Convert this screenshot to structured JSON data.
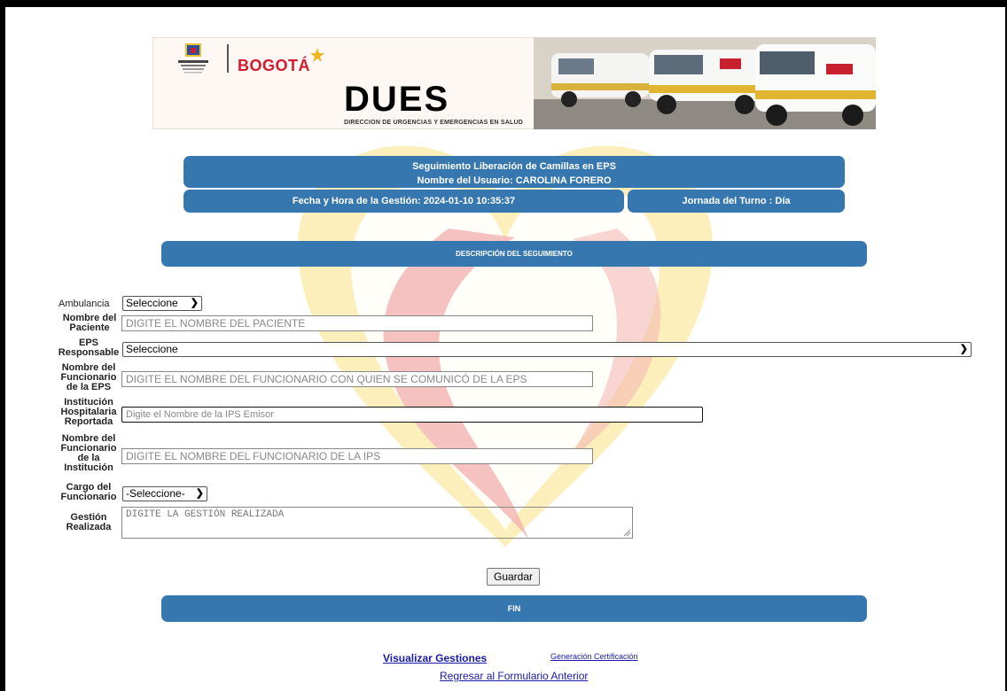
{
  "banner": {
    "brand": "BOGOTÁ",
    "title": "DUES",
    "subtitle": "DIRECCION DE URGENCIAS Y EMERGENCIAS EN SALUD"
  },
  "header": {
    "form_title": "Seguimiento Liberación de Camillas en EPS",
    "user_label": "Nombre del Usuario: CAROLINA FORERO",
    "datetime_label": "Fecha y Hora de la Gestión: 2024-01-10 10:35:37",
    "shift_label": "Jornada del Turno : Día"
  },
  "section_title": "DESCRIPCIÓN DEL SEGUIMIENTO",
  "form": {
    "ambulancia": {
      "label": "Ambulancia",
      "value": "Seleccione"
    },
    "paciente": {
      "label": [
        "Nombre del",
        "Paciente"
      ],
      "placeholder": "DIGITE EL NOMBRE DEL PACIENTE"
    },
    "eps": {
      "label": [
        "EPS",
        "Responsable"
      ],
      "value": "Seleccione"
    },
    "funcionario_eps": {
      "label": [
        "Nombre del",
        "Funcionario",
        "de la EPS"
      ],
      "placeholder": "DIGITE EL NOMBRE DEL FUNCIONARIO CON QUIEN SE COMUNICÓ DE LA EPS"
    },
    "institucion": {
      "label": [
        "Institución",
        "Hospitalaria",
        "Reportada"
      ],
      "placeholder": "Digite el Nombre de la IPS Emisor"
    },
    "funcionario_ips": {
      "label": [
        "Nombre del",
        "Funcionario",
        "de la",
        "Institución"
      ],
      "placeholder": "DIGITE EL NOMBRE DEL FUNCIONARIO DE LA IPS"
    },
    "cargo": {
      "label": [
        "Cargo del",
        "Funcionario"
      ],
      "value": "-Seleccione-"
    },
    "gestion": {
      "label": [
        "Gestión",
        "Realizada"
      ],
      "placeholder": "DIGITE LA GESTIÓN REALIZADA"
    },
    "save_label": "Guardar"
  },
  "footer_title": "FIN",
  "links": {
    "visualizar": "Visualizar Gestiones",
    "certificacion": "Generación Certificación",
    "regresar": "Regresar al Formulario Anterior"
  },
  "colors": {
    "bar_blue": "#3777b0",
    "link_blue": "#1a1aa8",
    "brand_red": "#d6192b"
  }
}
